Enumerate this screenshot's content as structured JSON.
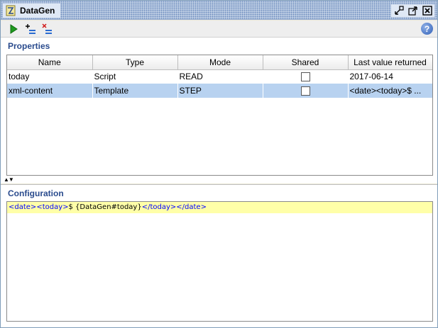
{
  "window": {
    "title": "DataGen",
    "icon": "datagen-icon"
  },
  "toolbar": {
    "run_icon": "play-icon",
    "add_icon": "add-property-icon",
    "remove_icon": "remove-property-icon",
    "help_label": "?"
  },
  "properties": {
    "header": "Properties",
    "columns": [
      "Name",
      "Type",
      "Mode",
      "Shared",
      "Last value returned"
    ],
    "rows": [
      {
        "name": "today",
        "type": "Script",
        "mode": "READ",
        "shared": false,
        "last_value": "2017-06-14"
      },
      {
        "name": "xml-content",
        "type": "Template",
        "mode": "STEP",
        "shared": false,
        "last_value": "<date><today>$ ..."
      }
    ],
    "selected_row": 1
  },
  "splitter": {
    "arrows": "▲▼"
  },
  "configuration": {
    "header": "Configuration",
    "tokens": [
      {
        "kind": "tag",
        "text": "<date>"
      },
      {
        "kind": "tag",
        "text": "<today>"
      },
      {
        "kind": "txt",
        "text": "$ {DataGen#today}"
      },
      {
        "kind": "tag",
        "text": "</today>"
      },
      {
        "kind": "tag",
        "text": "</date>"
      }
    ],
    "highlight_color": "#ffffa8"
  },
  "colors": {
    "section_header": "#2a4b8d",
    "selected_row": "#b8d2f0",
    "tag": "#0000ff"
  }
}
